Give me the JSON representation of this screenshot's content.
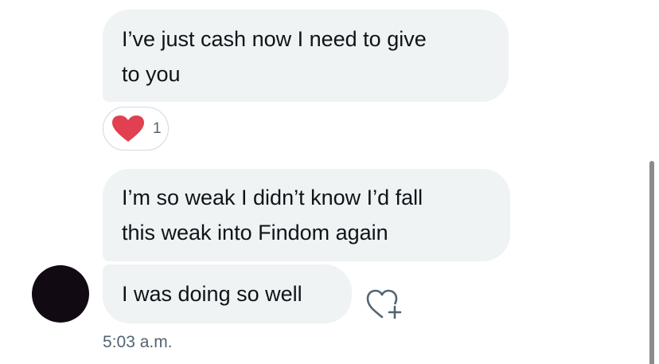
{
  "messages": [
    {
      "text": "I’ve just cash now I need to give\nto you"
    },
    {
      "text": "I’m so weak I didn’t know I’d fall\nthis weak into Findom again"
    },
    {
      "text": "I was doing so well"
    }
  ],
  "reaction": {
    "icon": "heart-icon",
    "count": "1",
    "color": "#e0404f"
  },
  "timestamp": "5:03 a.m.",
  "colors": {
    "bubble": "#eff3f4",
    "text": "#0f1419",
    "secondary_text": "#536471",
    "avatar": "#120a12"
  }
}
